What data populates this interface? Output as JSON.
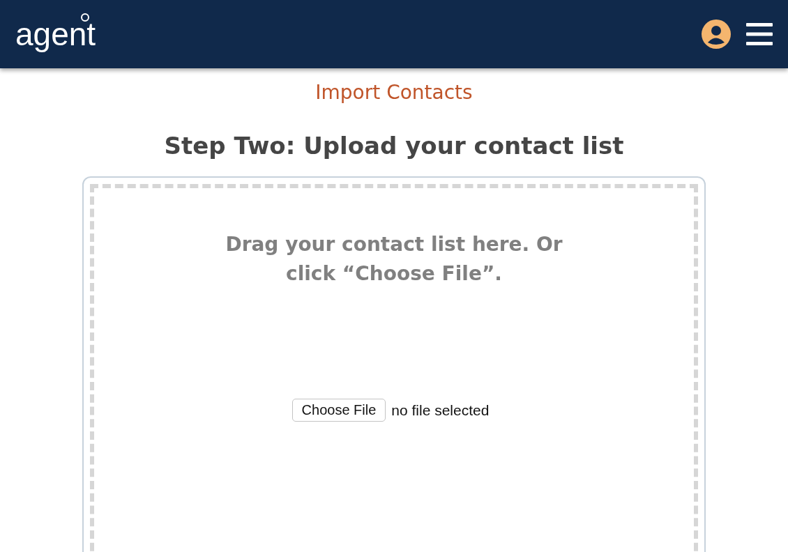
{
  "header": {
    "logo": "agent"
  },
  "page_title": "Import Contacts",
  "step_heading": "Step Two: Upload your contact list",
  "dropzone": {
    "instructions": "Drag your contact list here. Or click “Choose File”.",
    "file_button": "Choose File",
    "file_status": "no file selected"
  }
}
